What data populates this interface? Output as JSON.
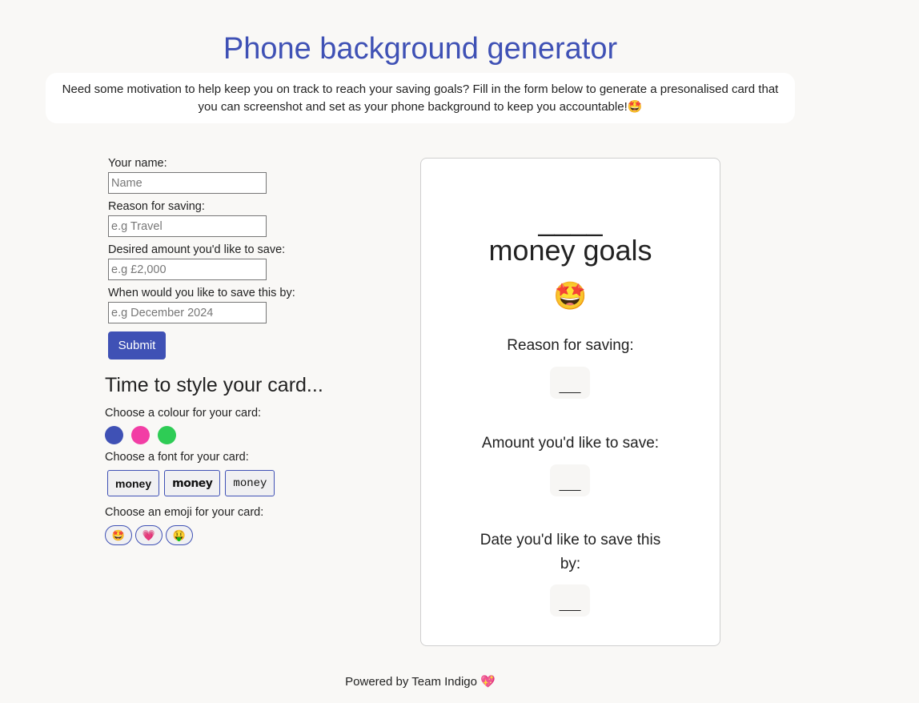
{
  "header": {
    "title": "Phone background generator",
    "intro": "Need some motivation to help keep you on track to reach your saving goals? Fill in the form below to generate a presonalised card that you can screenshot and set as your phone background to keep you accountable!🤩"
  },
  "form": {
    "name_label": "Your name:",
    "name_placeholder": "Name",
    "name_value": "",
    "reason_label": "Reason for saving:",
    "reason_placeholder": "e.g Travel",
    "reason_value": "",
    "amount_label": "Desired amount you'd like to save:",
    "amount_placeholder": "e.g £2,000",
    "amount_value": "",
    "date_label": "When would you like to save this by:",
    "date_placeholder": "e.g December 2024",
    "date_value": "",
    "submit_label": "Submit"
  },
  "style": {
    "heading": "Time to style your card...",
    "colour_label": "Choose a colour for your card:",
    "colours": [
      "#3f51b5",
      "#f23ea5",
      "#2ecc55"
    ],
    "font_label": "Choose a font for your card:",
    "fonts": [
      "money",
      "money",
      "money"
    ],
    "emoji_label": "Choose an emoji for your card:",
    "emojis": [
      "🤩",
      "💗",
      "🤑"
    ]
  },
  "card": {
    "name_placeholder": "____",
    "goals_text": "money goals",
    "emoji": "🤩",
    "reason_label": "Reason for saving:",
    "reason_value": "___",
    "amount_label": "Amount you'd like to save:",
    "amount_value": "___",
    "date_label": "Date you'd like to save this by:",
    "date_value": "___"
  },
  "footer": {
    "text": "Powered by Team Indigo",
    "icon": "💖"
  },
  "colors": {
    "accent": "#3f51b5",
    "background": "#f9f8f6"
  }
}
